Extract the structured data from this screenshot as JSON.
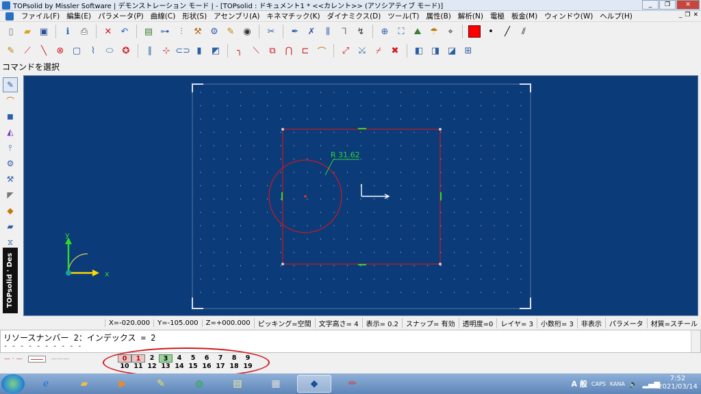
{
  "window": {
    "title": "TOPsolid by Missler Software | デモンストレーション モード | - [TOPsolid : ドキュメント1 *  <<カレント>> (アソシアティブ モード)]",
    "buttons": [
      "_",
      "❐",
      "✕"
    ]
  },
  "menubar": {
    "items": [
      "ファイル(F)",
      "編集(E)",
      "パラメータ(P)",
      "曲線(C)",
      "形状(S)",
      "アセンブリ(A)",
      "キネマチック(K)",
      "ダイナミクス(D)",
      "ツール(T)",
      "属性(B)",
      "解析(N)",
      "電極",
      "板金(M)",
      "ウィンドウ(W)",
      "ヘルプ(H)"
    ],
    "mdi_buttons": [
      "_",
      "❐",
      "✕"
    ]
  },
  "toolbar1": {
    "icons": [
      "new-document-icon",
      "open-folder-icon",
      "save-icon",
      "info-icon",
      "print-icon",
      "delete-icon",
      "undo-icon",
      "pane-icon",
      "measure-icon",
      "parameter-icon",
      "hammer-icon",
      "tools-icon",
      "paint-icon",
      "eye-icon",
      "scissors-icon",
      "pen-icon",
      "cross-icon",
      "sliders-icon",
      "hook-icon",
      "cursor-icon",
      "zoom-icon",
      "fit-screen-icon",
      "view-icon",
      "render-icon",
      "axis-icon",
      "color-swatch-icon",
      "point-style-icon",
      "line-style-icon",
      "hatch-icon"
    ],
    "color_swatch": "#ff0000"
  },
  "toolbar2": {
    "icons": [
      "pencil-icon",
      "polyline-icon",
      "line-icon",
      "circle-cross-icon",
      "rectangle-icon",
      "trim-icon",
      "ellipse-icon",
      "star-icon",
      "double-line-icon",
      "point-icon",
      "slot-icon",
      "block-icon",
      "cube-icon",
      "fillet-icon",
      "chamfer-icon",
      "offset-icon",
      "arc-icon",
      "corner-icon",
      "tangent-icon",
      "projection-icon",
      "intersection-icon",
      "break-icon",
      "cancel-icon",
      "surface-icon",
      "shell-icon",
      "solid-icon",
      "tree-icon"
    ]
  },
  "command_prompt": "コマンドを選択",
  "left_toolbar": {
    "icons": [
      "pencil-icon",
      "curve-icon",
      "solid-icon",
      "surface-icon",
      "probe-icon",
      "sheetmetal-icon",
      "assembly-icon",
      "drafting-icon",
      "mold-icon",
      "electrode-icon",
      "fixture-icon",
      "design-icon"
    ],
    "brand": "TOPsolid ' Des"
  },
  "viewport": {
    "background": "#0b3b78",
    "radius_label": "R 31.62",
    "axis_y": "y",
    "axis_x": "x"
  },
  "statusbar": {
    "fields": [
      "X=-020.000",
      "Y=-105.000",
      "Z=+000.000",
      "ピッキング=空間",
      "文字高さ=  4",
      "表示=  0.2",
      "スナップ= 有効",
      "透明度=0",
      "レイヤ=  3",
      "小数桁= 3",
      "非表示",
      "パラメータ",
      "材質=スチール"
    ]
  },
  "message": {
    "line1": "リソースナンバー 2：インデックス = 2",
    "line2": "- - - - - - - - - -"
  },
  "layers": {
    "row1": [
      "0",
      "1",
      "2",
      "3",
      "4",
      "5",
      "6",
      "7",
      "8",
      "9"
    ],
    "row2": [
      "10",
      "11",
      "12",
      "13",
      "14",
      "15",
      "16",
      "17",
      "18",
      "19"
    ]
  },
  "taskbar": {
    "apps": [
      "explorer-icon",
      "ie-icon",
      "folder-icon",
      "media-icon",
      "paint-icon",
      "chrome-icon",
      "notes-icon",
      "calculator-icon",
      "topsolid-icon",
      "paintbrush-icon"
    ],
    "ime": "A 般",
    "caps": "CAPS",
    "kana": "KANA",
    "time": "7:52",
    "date": "2021/03/14"
  }
}
